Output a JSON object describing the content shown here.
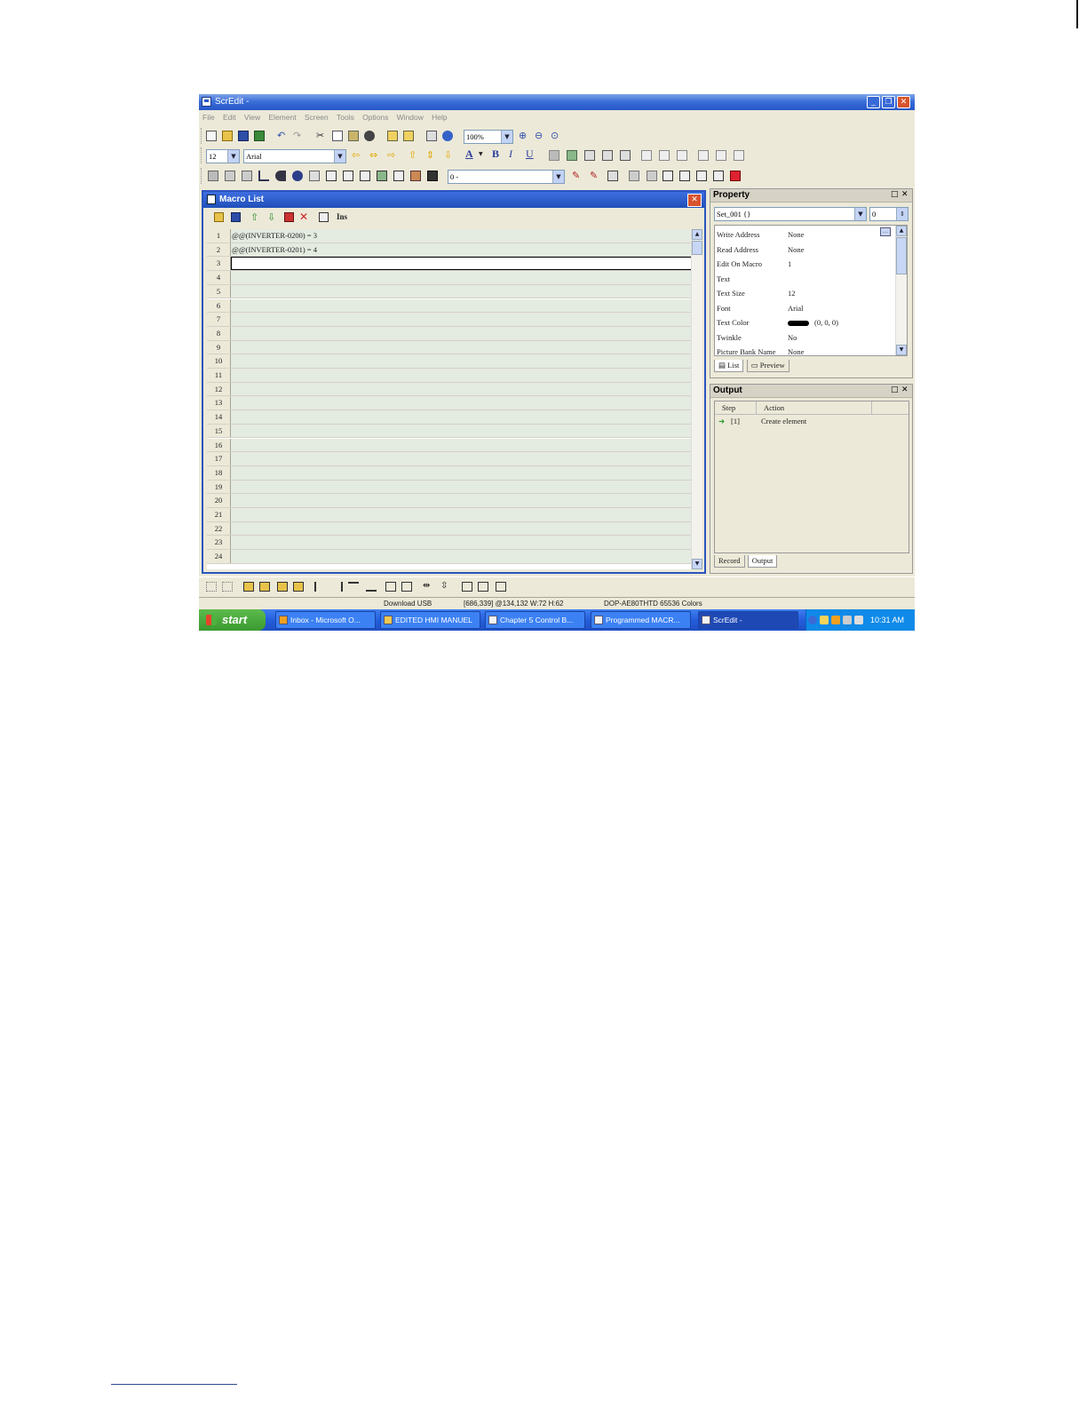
{
  "window": {
    "title": "ScrEdit -"
  },
  "menu": [
    "File",
    "Edit",
    "View",
    "Element",
    "Screen",
    "Tools",
    "Options",
    "Window",
    "Help"
  ],
  "toolbar": {
    "zoom": "100%",
    "font_size": "12",
    "font_name": "Arial",
    "layer_select": "0 -",
    "text_buttons": {
      "color": "A",
      "bold": "B",
      "italic": "I",
      "underline": "U"
    }
  },
  "macro_list": {
    "title": "Macro List",
    "ins_label": "Ins",
    "rows": [
      {
        "n": "1",
        "code": "@@(INVERTER-0200) = 3"
      },
      {
        "n": "2",
        "code": "@@(INVERTER-0201) = 4"
      },
      {
        "n": "3",
        "code": ""
      },
      {
        "n": "4",
        "code": ""
      },
      {
        "n": "5",
        "code": ""
      },
      {
        "n": "6",
        "code": ""
      },
      {
        "n": "7",
        "code": ""
      },
      {
        "n": "8",
        "code": ""
      },
      {
        "n": "9",
        "code": ""
      },
      {
        "n": "10",
        "code": ""
      },
      {
        "n": "11",
        "code": ""
      },
      {
        "n": "12",
        "code": ""
      },
      {
        "n": "13",
        "code": ""
      },
      {
        "n": "14",
        "code": ""
      },
      {
        "n": "15",
        "code": ""
      },
      {
        "n": "16",
        "code": ""
      },
      {
        "n": "17",
        "code": ""
      },
      {
        "n": "18",
        "code": ""
      },
      {
        "n": "19",
        "code": ""
      },
      {
        "n": "20",
        "code": ""
      },
      {
        "n": "21",
        "code": ""
      },
      {
        "n": "22",
        "code": ""
      },
      {
        "n": "23",
        "code": ""
      },
      {
        "n": "24",
        "code": ""
      }
    ],
    "selected_row": 3
  },
  "property": {
    "title": "Property",
    "object": "Set_001 {}",
    "index": "0",
    "rows": [
      {
        "key": "Write Address",
        "value": "None"
      },
      {
        "key": "Read Address",
        "value": "None"
      },
      {
        "key": "Edit On Macro",
        "value": "1"
      },
      {
        "key": "Text",
        "value": ""
      },
      {
        "key": "Text Size",
        "value": "12"
      },
      {
        "key": "Font",
        "value": "Arial"
      },
      {
        "key": "Text Color",
        "value": "(0, 0, 0)"
      },
      {
        "key": "Twinkle",
        "value": "No"
      },
      {
        "key": "Picture Bank Name",
        "value": "None"
      }
    ],
    "text_color_swatch": "#000000",
    "tabs": [
      "List",
      "Preview"
    ]
  },
  "output": {
    "title": "Output",
    "columns": [
      "Step",
      "Action"
    ],
    "entries": [
      {
        "step": "[1]",
        "action": "Create element"
      }
    ],
    "tabs": [
      "Record",
      "Output"
    ]
  },
  "status": {
    "download": "Download USB",
    "coords": "[686,339] @134,132 W:72 H:62",
    "model": "DOP-AE80THTD 65536 Colors"
  },
  "taskbar": {
    "start": "start",
    "tasks": [
      "Inbox - Microsoft O...",
      "EDITED HMI MANUEL",
      "Chapter 5 Control B...",
      "Programmed MACR...",
      "ScrEdit -"
    ],
    "clock": "10:31 AM"
  }
}
